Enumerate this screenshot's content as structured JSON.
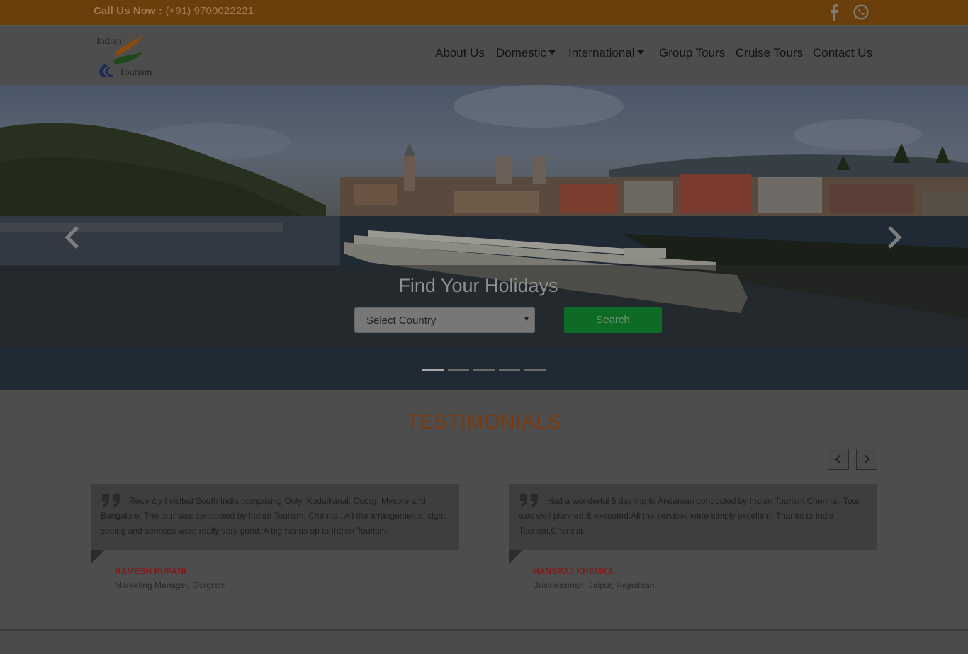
{
  "topbar": {
    "call_label": "Call Us Now :",
    "phone": "(+91) 9700022221",
    "social": [
      "facebook-icon",
      "whatsapp-icon"
    ]
  },
  "header": {
    "logo": {
      "line1": "Indian",
      "line2": "Tourism"
    },
    "nav": [
      {
        "label": "About Us",
        "dropdown": false
      },
      {
        "label": "Domestic",
        "dropdown": true
      },
      {
        "label": "International",
        "dropdown": true
      },
      {
        "label": "Group Tours",
        "dropdown": false
      },
      {
        "label": "Cruise Tours",
        "dropdown": false
      },
      {
        "label": "Contact Us",
        "dropdown": false
      }
    ]
  },
  "hero": {
    "heading": "Find Your Holidays",
    "select": {
      "selected": "Select Country"
    },
    "search_label": "Search",
    "slide_count": 5,
    "active_slide": 1
  },
  "testimonials": {
    "title": "TESTIMONIALS",
    "items": [
      {
        "text": "Recently I visited South India comprising Ooty, Kodaikanal, Coorg, Mysore and Bangalore. The tour was conducted by Indian Tourism, Chennai. All the arrangements, sight seeing and services were really very good. A big hands up to Indian Tourism.",
        "name": "RAMESH RUPANI",
        "role": "Marketing Manager, Gurgram"
      },
      {
        "text": "Had a wonderful 5 day trip to Andaman conducted by Indian Tourism,Chennai. Tour was well planned & executed.All the services were simply excellent. Thanks to India Tourism,Chennai.",
        "name": "HANSRAJ KHEMKA",
        "role": "Businessman, Jaipur, Rajasthan"
      }
    ]
  },
  "colors": {
    "topbar": "#6b3f0c",
    "title_accent": "#7a3a0e",
    "search_button": "#0e6b25",
    "name_text": "#7d1c1c"
  }
}
